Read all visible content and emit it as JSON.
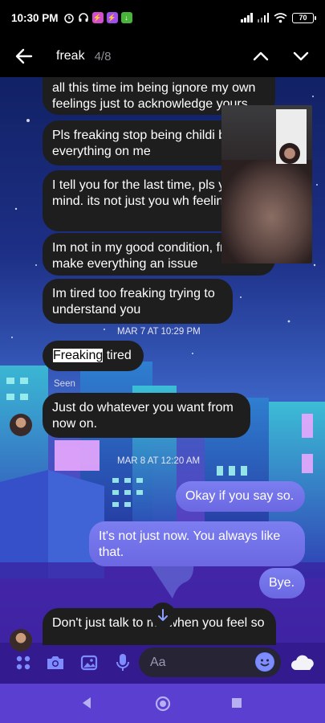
{
  "status_bar": {
    "time": "10:30 PM",
    "battery": "70",
    "icons": [
      "alarm-icon",
      "headphones-icon",
      "messenger-icon",
      "messenger-icon",
      "download-icon",
      "signal-icon",
      "signal-icon",
      "wifi-icon",
      "battery-icon"
    ]
  },
  "search": {
    "query": "freak",
    "count": "4/8"
  },
  "messages": [
    {
      "text": "all this time im being ignore my own feelings just to acknowledge yours"
    },
    {
      "text": "Pls freaking stop being childi blaming everything on me"
    },
    {
      "text": "I tell you for the last time, pls your mind. its not just you wh feelings"
    },
    {
      "text": "Im not in my good condition, freaking make everything an issue"
    },
    {
      "text": "Im tired too freaking trying to understand you"
    }
  ],
  "timestamp_1": "MAR 7 AT 10:29 PM",
  "msg_freaking": {
    "highlight": "Freaking",
    "rest": " tired"
  },
  "seen_label": "Seen",
  "msg_whatever": "Just do whatever you want from now on.",
  "timestamp_2": "MAR 8 AT 12:20 AM",
  "sent": [
    {
      "text": "Okay if you say so."
    },
    {
      "text": "It's not just now.  You always like that."
    },
    {
      "text": "Bye."
    }
  ],
  "last_message": "Don't just talk to me when you feel so",
  "composer": {
    "placeholder": "Aa"
  },
  "colors": {
    "accent": "#6f6ee4",
    "received_bubble": "#1e1e1f",
    "highlight": "#ffffff"
  }
}
